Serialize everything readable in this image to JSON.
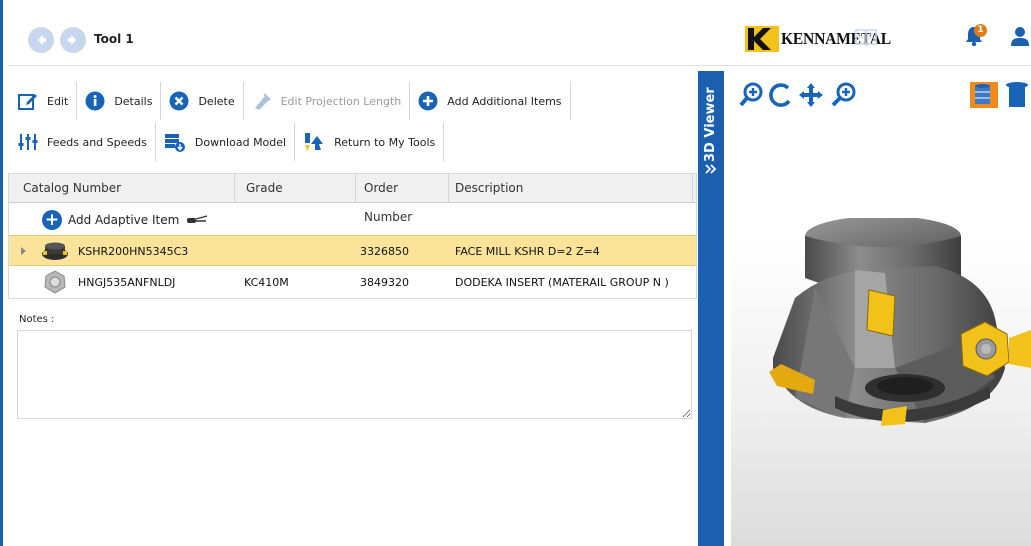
{
  "header": {
    "tool_title": "Tool 1",
    "logo_text": "KENNAMETAL",
    "notification_count": "1",
    "icons": [
      "back-arrow-icon",
      "forward-arrow-icon",
      "book-icon",
      "bell-icon",
      "user-icon"
    ]
  },
  "toolbar": {
    "edit": "Edit",
    "details": "Details",
    "delete": "Delete",
    "edit_projection_length": "Edit Projection Length",
    "add_additional_items": "Add Additional Items",
    "feeds_and_speeds": "Feeds and Speeds",
    "download_model": "Download Model",
    "return_to_my_tools": "Return to My Tools"
  },
  "grid": {
    "columns": [
      "Catalog Number",
      "Grade",
      "Order Number",
      "Description"
    ],
    "add_item_label": "Add Adaptive Item",
    "rows": [
      {
        "catalog_number": "KSHR200HN5345C3",
        "grade": "",
        "order_number": "3326850",
        "description": "FACE MILL KSHR D=2 Z=4",
        "selected": true
      },
      {
        "catalog_number": "HNGJ535ANFNLDJ",
        "grade": "KC410M",
        "order_number": "3849320",
        "description": "DODEKA INSERT (MATERAIL GROUP N )",
        "selected": false
      }
    ]
  },
  "notes": {
    "label": "Notes :",
    "value": ""
  },
  "viewer": {
    "tab_label": "3D Viewer",
    "tools": [
      "zoom-in-icon",
      "rotate-icon",
      "pan-icon",
      "zoom-extents-icon",
      "view-solid-icon",
      "view-transparent-icon"
    ]
  },
  "colors": {
    "accent": "#1b5fae",
    "selection": "#fbe49a",
    "insert_yellow": "#f2c21b"
  }
}
